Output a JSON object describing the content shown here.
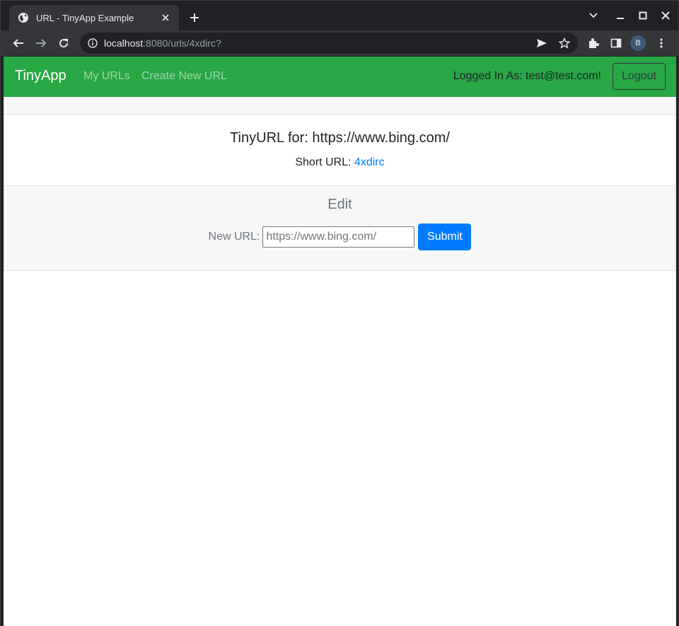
{
  "browser": {
    "tab_title": "URL - TinyApp Example",
    "url_host": "localhost",
    "url_rest": ":8080/urls/4xdirc?",
    "profile_initial": "B",
    "colors": {
      "frame": "#202124",
      "toolbar": "#35363a"
    }
  },
  "navbar": {
    "brand": "TinyApp",
    "links": [
      "My URLs",
      "Create New URL"
    ],
    "logged_in_text": "Logged In As: test@test.com!",
    "logout_label": "Logout",
    "color": "#28a745"
  },
  "url_card": {
    "title": "TinyURL for: https://www.bing.com/",
    "short_url_label": "Short URL:",
    "short_url_value": "4xdirc"
  },
  "edit": {
    "heading": "Edit",
    "new_url_label": "New URL:",
    "input_placeholder": "https://www.bing.com/",
    "submit_label": "Submit",
    "submit_color": "#007bff"
  }
}
